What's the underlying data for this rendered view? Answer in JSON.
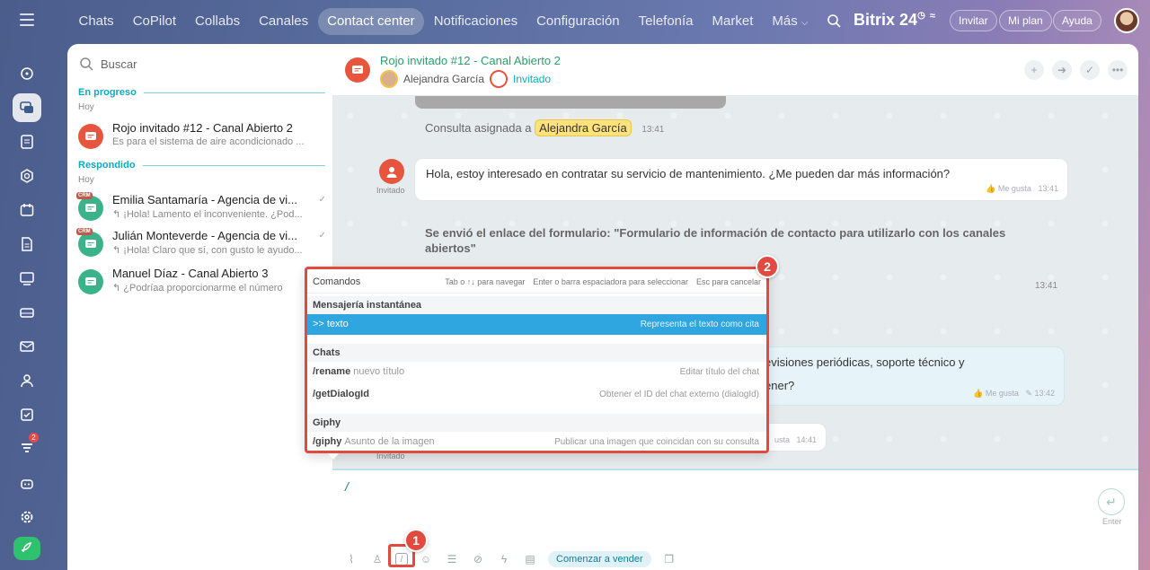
{
  "topbar": {
    "nav": [
      "Chats",
      "CoPilot",
      "Collabs",
      "Canales",
      "Contact center",
      "Notificaciones",
      "Configuración",
      "Telefonía",
      "Market",
      "Más"
    ],
    "active_nav": "Contact center",
    "brand": "Bitrix",
    "brand_num": "24",
    "invite": "Invitar",
    "plan": "Mi plan",
    "help": "Ayuda"
  },
  "rail": {
    "notif_count": "2"
  },
  "list": {
    "search_placeholder": "Buscar",
    "section1": "En progreso",
    "section2": "Respondido",
    "today": "Hoy",
    "items": [
      {
        "title": "Rojo invitado #12 - Canal Abierto 2",
        "sub": "Es para el sistema de aire acondicionado ..."
      },
      {
        "title": "Emilia Santamaría - Agencia de vi...",
        "sub": "¡Hola! Lamento el inconveniente. ¿Pod...",
        "tag": "CRM"
      },
      {
        "title": "Julián Monteverde - Agencia de vi...",
        "sub": "¡Hola! Claro que sí, con gusto le ayudo...",
        "tag": "CRM"
      },
      {
        "title": "Manuel Díaz - Canal Abierto 3",
        "sub": "¿Podríaa proporcionarme el número"
      }
    ]
  },
  "chat": {
    "title": "Rojo invitado #12 - Canal Abierto 2",
    "agent": "Alejandra García",
    "guest": "Invitado",
    "assigned_text": "Consulta asignada a",
    "assigned_name": "Alejandra García",
    "assigned_time": "13:41",
    "msg1": "Hola, estoy interesado en contratar su servicio de mantenimiento. ¿Me pueden dar más información?",
    "like": "Me gusta",
    "msg1_time": "13:41",
    "form_msg": "Se envió el enlace del formulario: \"Formulario de información de contacto para utilizarlo con los canales abiertos\"",
    "form_time": "13:41",
    "reply_line1": "evisiones periódicas, soporte técnico y",
    "reply_line2": "ener?",
    "reply_time": "13:42",
    "partial_like": "usta",
    "partial_time": "14:41",
    "guest_label": "Invitado",
    "send_label": "Enter",
    "composer_value": "/",
    "sell_label": "Comenzar a vender"
  },
  "commands": {
    "title": "Comandos",
    "hint1": "Tab o ↑↓ para navegar",
    "hint2": "Enter o barra espaciadora para seleccionar",
    "hint3": "Esc para cancelar",
    "groups": [
      {
        "name": "Mensajería instantánea",
        "rows": [
          {
            "cmd": ">>",
            "arg": "texto",
            "desc": "Representa el texto como cita"
          }
        ]
      },
      {
        "name": "Chats",
        "rows": [
          {
            "cmd": "/rename",
            "arg": "nuevo título",
            "desc": "Editar título del chat"
          },
          {
            "cmd": "/getDialogId",
            "arg": "",
            "desc": "Obtener el ID del chat externo (dialogId)"
          }
        ]
      },
      {
        "name": "Giphy",
        "rows": [
          {
            "cmd": "/giphy",
            "arg": "Asunto de la imagen",
            "desc": "Publicar una imagen que coincidan con su consulta"
          }
        ]
      }
    ]
  },
  "callouts": [
    "1",
    "2"
  ],
  "colors": {
    "accent": "#2fa6df",
    "callout": "#e04a3f",
    "green": "#2aa06b"
  }
}
